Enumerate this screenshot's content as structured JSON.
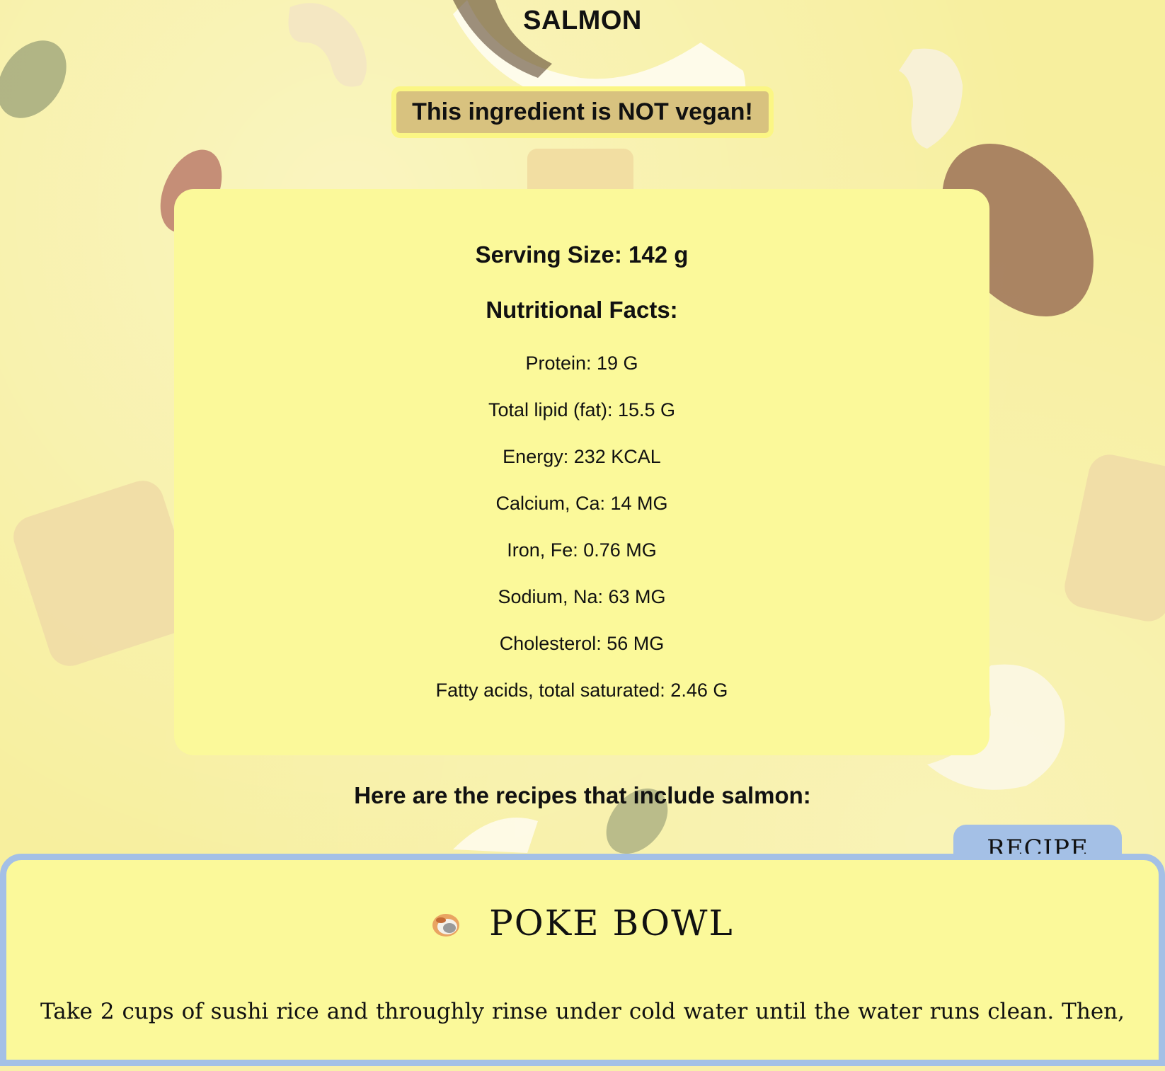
{
  "ingredient": {
    "name": "SALMON",
    "vegan_status": "This ingredient is NOT vegan!"
  },
  "nutrition": {
    "serving_size": "Serving Size: 142 g",
    "heading": "Nutritional Facts:",
    "facts": [
      "Protein: 19 G",
      "Total lipid (fat): 15.5 G",
      "Energy: 232 KCAL",
      "Calcium, Ca: 14 MG",
      "Iron, Fe: 0.76 MG",
      "Sodium, Na: 63 MG",
      "Cholesterol: 56 MG",
      "Fatty acids, total saturated: 2.46 G"
    ]
  },
  "recipes": {
    "heading": "Here are the recipes that include salmon:",
    "tab_label": "RECIPE",
    "items": [
      {
        "icon": "bowl-icon",
        "title": "POKE BOWL",
        "description": "Take 2 cups of sushi rice and throughly rinse under cold water until the water runs clean. Then,"
      }
    ]
  },
  "colors": {
    "background": "#f7ef9e",
    "card": "#fbf99a",
    "badge": "#d8c27f",
    "badge_border": "#fbf684",
    "recipe_accent": "#a4c0e6"
  }
}
